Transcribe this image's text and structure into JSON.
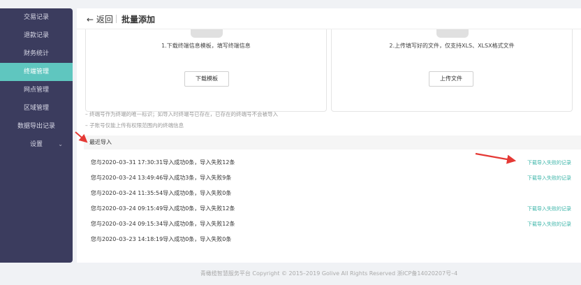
{
  "sidebar": {
    "items": [
      {
        "label": "交易记录"
      },
      {
        "label": "退款记录"
      },
      {
        "label": "财务统计"
      },
      {
        "label": "终端管理"
      },
      {
        "label": "网点管理"
      },
      {
        "label": "区域管理"
      },
      {
        "label": "数据导出记录"
      },
      {
        "label": "设置"
      }
    ],
    "active_index": 3
  },
  "header": {
    "back_label": "← 返回",
    "title": "批量添加"
  },
  "steps": {
    "download": {
      "text": "1.下载终端信息模板，填写终端信息",
      "button": "下载模板"
    },
    "upload": {
      "text": "2.上传填写好的文件，仅支持XLS、XLSX格式文件",
      "button": "上传文件"
    }
  },
  "notes": [
    "– 终端号作为终端的唯一标识；如导入时终端号已存在，已存在的终端号不会被导入",
    "– 子账号仅能上传有权限范围内的终端信息"
  ],
  "recent": {
    "title": "最近导入",
    "rows": [
      {
        "text": "您与2020–03–31 17:30:31导入成功0条，导入失败12条",
        "link": "下载导入失败的记录"
      },
      {
        "text": "您与2020–03–24 13:49:46导入成功3条，导入失败9条",
        "link": "下载导入失败的记录"
      },
      {
        "text": "您与2020–03–24 11:35:54导入成功0条，导入失败0条",
        "link": ""
      },
      {
        "text": "您与2020–03–24 09:15:49导入成功0条，导入失败12条",
        "link": "下载导入失败的记录"
      },
      {
        "text": "您与2020–03–24 09:15:34导入成功0条，导入失败12条",
        "link": "下载导入失败的记录"
      },
      {
        "text": "您与2020–03–23 14:18:19导入成功0条，导入失败0条",
        "link": ""
      }
    ]
  },
  "footer": {
    "text": "青橄榄智慧服务平台 Copyright © 2015–2019 Golive All Rights Reserved   浙ICP备14020207号–4"
  },
  "colors": {
    "sidebar_bg": "#3b3c5e",
    "active": "#5fc6bf",
    "link": "#3bb4a8",
    "annotation_arrow": "#e53935"
  }
}
